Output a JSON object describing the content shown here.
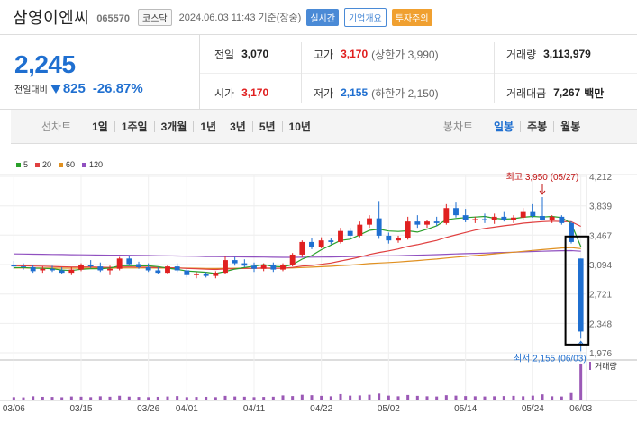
{
  "header": {
    "stock_name": "삼영이엔씨",
    "stock_code": "065570",
    "market": "코스닥",
    "datetime": "2024.06.03 11:43 기준(장중)",
    "badges": [
      "실시간",
      "기업개요",
      "투자주의"
    ]
  },
  "quote": {
    "price": "2,245",
    "change_label": "전일대비",
    "change_amount": "825",
    "change_pct": "-26.87%",
    "prev_close_label": "전일",
    "prev_close": "3,070",
    "open_label": "시가",
    "open": "3,170",
    "high_label": "고가",
    "high": "3,170",
    "upper_limit": "(상한가 3,990)",
    "low_label": "저가",
    "low": "2,155",
    "lower_limit": "(하한가 2,150)",
    "volume_label": "거래량",
    "volume": "3,113,979",
    "amount_label": "거래대금",
    "amount": "7,267",
    "amount_unit": "백만"
  },
  "tabs": {
    "period_group": "선차트",
    "periods": [
      "1일",
      "1주일",
      "3개월",
      "1년",
      "3년",
      "5년",
      "10년"
    ],
    "candle_group": "봉차트",
    "candles": [
      "일봉",
      "주봉",
      "월봉"
    ],
    "selected_candle": "일봉"
  },
  "legend": [
    {
      "label": "5",
      "color": "#2aa02a"
    },
    {
      "label": "20",
      "color": "#e04040"
    },
    {
      "label": "60",
      "color": "#e09020"
    },
    {
      "label": "120",
      "color": "#9050c0"
    }
  ],
  "colors": {
    "up": "#e02020",
    "down": "#1f6fd0",
    "accent": "#1f6fd0"
  },
  "chart_data": {
    "type": "candlestick",
    "y_ticks": [
      4212,
      3839,
      3467,
      3094,
      2721,
      2348,
      1976
    ],
    "ylim": [
      1976,
      4212
    ],
    "x_tick_labels": [
      "03/06",
      "03/15",
      "03/26",
      "04/01",
      "04/11",
      "04/22",
      "05/02",
      "05/14",
      "05/24",
      "06/03"
    ],
    "x_tick_index": [
      0,
      7,
      14,
      18,
      25,
      32,
      39,
      47,
      54,
      59
    ],
    "high_annotation": "최고 3,950 (05/27)",
    "high_index": 55,
    "high_value": 3950,
    "low_annotation": "최저 2,155 (06/03)",
    "low_index": 59,
    "low_value": 2155,
    "volume_label": "거래량",
    "candles": [
      [
        0,
        3090,
        3140,
        3040,
        3070
      ],
      [
        1,
        3070,
        3110,
        3030,
        3060
      ],
      [
        2,
        3060,
        3090,
        2990,
        3010
      ],
      [
        3,
        3020,
        3070,
        2990,
        3040
      ],
      [
        4,
        3040,
        3080,
        3000,
        3020
      ],
      [
        5,
        3020,
        3060,
        2970,
        2990
      ],
      [
        6,
        2990,
        3060,
        2960,
        3030
      ],
      [
        7,
        3030,
        3110,
        3010,
        3090
      ],
      [
        8,
        3090,
        3150,
        3050,
        3070
      ],
      [
        9,
        3070,
        3120,
        3000,
        3020
      ],
      [
        10,
        3020,
        3080,
        2960,
        3040
      ],
      [
        11,
        3040,
        3190,
        3020,
        3170
      ],
      [
        12,
        3170,
        3200,
        3080,
        3100
      ],
      [
        13,
        3100,
        3130,
        3040,
        3060
      ],
      [
        14,
        3060,
        3110,
        3000,
        3020
      ],
      [
        15,
        3020,
        3060,
        2970,
        2990
      ],
      [
        16,
        2990,
        3090,
        2970,
        3070
      ],
      [
        17,
        3070,
        3110,
        3000,
        3020
      ],
      [
        18,
        3020,
        3040,
        2930,
        2960
      ],
      [
        19,
        2960,
        3000,
        2920,
        2980
      ],
      [
        20,
        2980,
        3000,
        2930,
        2950
      ],
      [
        21,
        2950,
        3010,
        2920,
        2990
      ],
      [
        22,
        2990,
        3200,
        2970,
        3150
      ],
      [
        23,
        3150,
        3190,
        3080,
        3110
      ],
      [
        24,
        3110,
        3160,
        3060,
        3080
      ],
      [
        25,
        3080,
        3120,
        3000,
        3040
      ],
      [
        26,
        3040,
        3110,
        3010,
        3090
      ],
      [
        27,
        3090,
        3120,
        3000,
        3030
      ],
      [
        28,
        3030,
        3110,
        3010,
        3090
      ],
      [
        29,
        3090,
        3240,
        3070,
        3220
      ],
      [
        30,
        3220,
        3400,
        3190,
        3380
      ],
      [
        31,
        3380,
        3430,
        3290,
        3320
      ],
      [
        32,
        3320,
        3440,
        3300,
        3400
      ],
      [
        33,
        3400,
        3430,
        3350,
        3380
      ],
      [
        34,
        3380,
        3560,
        3360,
        3520
      ],
      [
        35,
        3520,
        3560,
        3420,
        3460
      ],
      [
        36,
        3460,
        3640,
        3440,
        3600
      ],
      [
        37,
        3600,
        3720,
        3560,
        3680
      ],
      [
        38,
        3680,
        3900,
        3420,
        3460
      ],
      [
        39,
        3460,
        3500,
        3360,
        3400
      ],
      [
        40,
        3400,
        3460,
        3370,
        3430
      ],
      [
        41,
        3430,
        3700,
        3410,
        3640
      ],
      [
        42,
        3640,
        3720,
        3560,
        3600
      ],
      [
        43,
        3600,
        3660,
        3560,
        3640
      ],
      [
        44,
        3640,
        3700,
        3580,
        3620
      ],
      [
        45,
        3620,
        3860,
        3600,
        3810
      ],
      [
        46,
        3810,
        3880,
        3690,
        3720
      ],
      [
        47,
        3720,
        3800,
        3630,
        3660
      ],
      [
        48,
        3660,
        3700,
        3620,
        3670
      ],
      [
        49,
        3670,
        3740,
        3620,
        3660
      ],
      [
        50,
        3660,
        3740,
        3610,
        3700
      ],
      [
        51,
        3700,
        3760,
        3640,
        3660
      ],
      [
        52,
        3660,
        3720,
        3620,
        3690
      ],
      [
        53,
        3690,
        3810,
        3660,
        3760
      ],
      [
        54,
        3760,
        3860,
        3690,
        3710
      ],
      [
        55,
        3710,
        3950,
        3680,
        3660
      ],
      [
        56,
        3660,
        3720,
        3620,
        3700
      ],
      [
        57,
        3700,
        3720,
        3600,
        3620
      ],
      [
        58,
        3620,
        3640,
        3360,
        3380
      ],
      [
        59,
        3170,
        3170,
        2155,
        2245
      ]
    ],
    "volume": [
      22,
      20,
      30,
      25,
      24,
      21,
      28,
      26,
      22,
      30,
      26,
      35,
      27,
      24,
      22,
      25,
      28,
      32,
      22,
      24,
      25,
      22,
      34,
      28,
      26,
      22,
      24,
      26,
      38,
      32,
      44,
      40,
      34,
      30,
      50,
      36,
      38,
      44,
      55,
      36,
      30,
      42,
      34,
      30,
      28,
      40,
      36,
      32,
      30,
      28,
      30,
      32,
      34,
      30,
      36,
      48,
      30,
      28,
      60,
      330
    ]
  }
}
